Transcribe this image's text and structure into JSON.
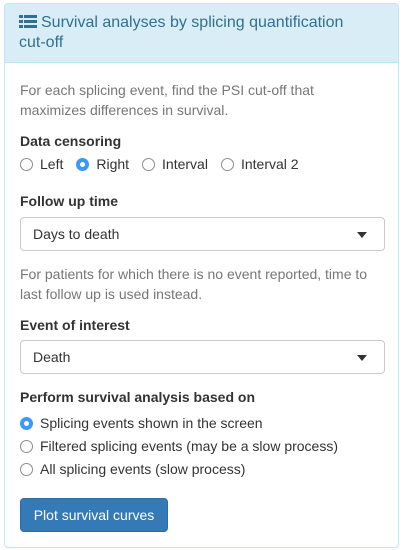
{
  "panel": {
    "title_line1": "Survival analyses by splicing quantification",
    "title_line2": "cut-off",
    "title_icon": "list-icon"
  },
  "description": {
    "line1": "For each splicing event, find the PSI cut-off that",
    "line2": "maximizes differences in survival."
  },
  "censoring": {
    "label": "Data censoring",
    "options": [
      "Left",
      "Right",
      "Interval",
      "Interval 2"
    ],
    "selected": "Right"
  },
  "follow_up": {
    "label": "Follow up time",
    "value": "Days to death",
    "help_line1": "For patients for which there is no event reported, time to",
    "help_line2": "last follow up is used instead."
  },
  "event": {
    "label": "Event of interest",
    "value": "Death"
  },
  "basis": {
    "label": "Perform survival analysis based on",
    "options": [
      "Splicing events shown in the screen",
      "Filtered splicing events (may be a slow process)",
      "All splicing events (slow process)"
    ],
    "selected": "Splicing events shown in the screen"
  },
  "actions": {
    "plot_label": "Plot survival curves"
  },
  "colors": {
    "heading_bg": "#d9edf7",
    "heading_text": "#31708f",
    "accent": "#3b99fc",
    "button": "#337ab7"
  }
}
